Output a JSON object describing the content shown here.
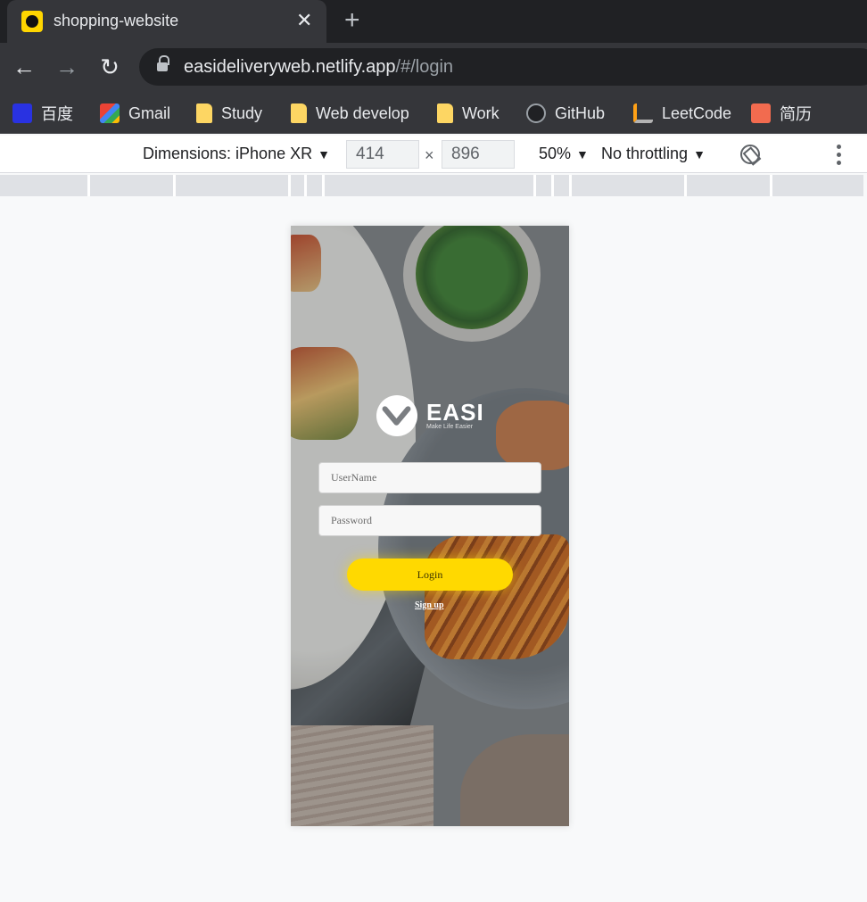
{
  "browser": {
    "tab_title": "shopping-website",
    "tab_close": "✕",
    "new_tab": "+",
    "url_host": "easideliveryweb.netlify.app",
    "url_path": "/#/login"
  },
  "bookmarks": [
    {
      "label": "百度",
      "icon": "baidu-icon"
    },
    {
      "label": "Gmail",
      "icon": "gmail-icon"
    },
    {
      "label": "Study",
      "icon": "folder-icon"
    },
    {
      "label": "Web develop",
      "icon": "folder-icon"
    },
    {
      "label": "Work",
      "icon": "folder-icon"
    },
    {
      "label": "GitHub",
      "icon": "github-icon"
    },
    {
      "label": "LeetCode",
      "icon": "leetcode-icon"
    },
    {
      "label": "简历",
      "icon": "resume-icon"
    }
  ],
  "devtools": {
    "dimensions_label": "Dimensions: iPhone XR",
    "width": "414",
    "height": "896",
    "times": "×",
    "zoom": "50%",
    "throttling": "No throttling",
    "caret": "▼"
  },
  "app": {
    "brand_name": "EASI",
    "brand_tagline": "Make Life Easier",
    "username_placeholder": "UserName",
    "password_placeholder": "Password",
    "login_label": "Login",
    "signup_label": "Sign up",
    "accent_color": "#ffd900"
  }
}
